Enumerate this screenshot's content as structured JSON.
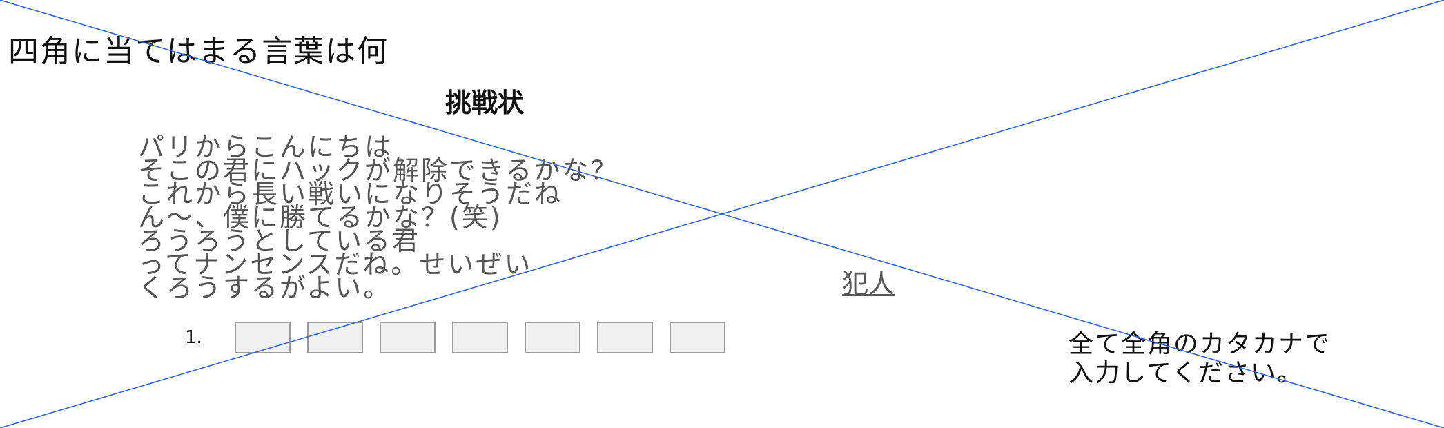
{
  "question": "四角に当てはまる言葉は何",
  "letter": {
    "title": "挑戦状",
    "lines": [
      "パリからこんにちは",
      "そこの君にハックが解除できるかな？",
      "これから長い戦いになりそうだね",
      "ん～、僕に勝てるかな？(笑)",
      "ろうろうとしている君",
      "ってナンセンスだね。せいぜい",
      "くろうするがよい。"
    ],
    "signature": "犯人"
  },
  "answer": {
    "number_label": "1.",
    "box_count": 7,
    "values": [
      "",
      "",
      "",
      "",
      "",
      "",
      ""
    ]
  },
  "hint": {
    "lines": [
      "全て全角のカタカナで",
      "入力してください。"
    ]
  },
  "colors": {
    "overlay_line": "#3366dd",
    "box_fill": "#f0f0f0",
    "box_border": "#9a9a9a",
    "letter_text": "#555555"
  }
}
